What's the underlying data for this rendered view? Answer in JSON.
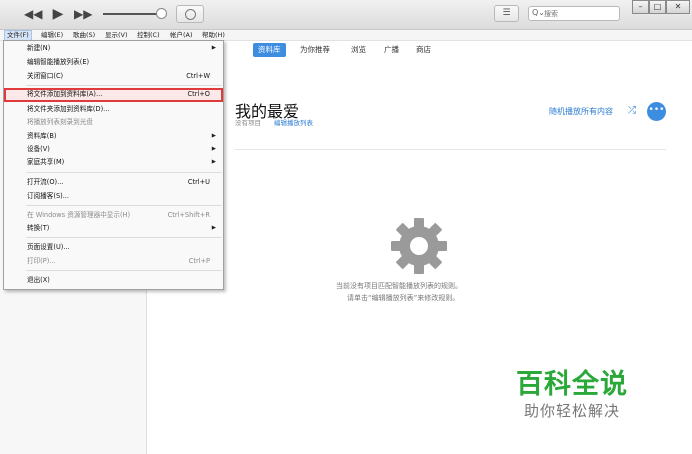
{
  "player": {
    "prev_icon": "◀◀",
    "play_icon": "▶",
    "next_icon": "▶▶",
    "list_icon": "☰",
    "search_placeholder": "搜索",
    "search_icon": "Q⌄",
    "minimize": "–",
    "restore": "□",
    "close": "✕"
  },
  "menubar": {
    "items": [
      {
        "label": "文件(F)"
      },
      {
        "label": "编辑(E)"
      },
      {
        "label": "歌曲(S)"
      },
      {
        "label": "显示(V)"
      },
      {
        "label": "控制(C)"
      },
      {
        "label": "帐户(A)"
      },
      {
        "label": "帮助(H)"
      }
    ]
  },
  "file_menu": {
    "items": [
      {
        "label": "新建(N)",
        "shortcut": "",
        "submenu": true,
        "disabled": false
      },
      {
        "label": "编辑智能播放列表(E)",
        "shortcut": "",
        "submenu": false,
        "disabled": false
      },
      {
        "label": "关闭窗口(C)",
        "shortcut": "Ctrl+W",
        "submenu": false,
        "disabled": false
      },
      {
        "label": "将文件添加到资料库(A)...",
        "shortcut": "Ctrl+O",
        "submenu": false,
        "disabled": false,
        "highlighted": true
      },
      {
        "label": "将文件夹添加到资料库(D)...",
        "shortcut": "",
        "submenu": false,
        "disabled": false
      },
      {
        "label": "将播放列表刻录到光盘",
        "shortcut": "",
        "submenu": false,
        "disabled": true
      },
      {
        "label": "资料库(B)",
        "shortcut": "",
        "submenu": true,
        "disabled": false
      },
      {
        "label": "设备(V)",
        "shortcut": "",
        "submenu": true,
        "disabled": false
      },
      {
        "label": "家庭共享(M)",
        "shortcut": "",
        "submenu": true,
        "disabled": false
      },
      {
        "label": "打开流(O)...",
        "shortcut": "Ctrl+U",
        "submenu": false,
        "disabled": false
      },
      {
        "label": "订阅播客(S)...",
        "shortcut": "",
        "submenu": false,
        "disabled": false
      },
      {
        "label": "在 Windows 资源管理器中显示(H)",
        "shortcut": "Ctrl+Shift+R",
        "submenu": false,
        "disabled": true
      },
      {
        "label": "转换(T)",
        "shortcut": "",
        "submenu": true,
        "disabled": false
      },
      {
        "label": "页面设置(U)...",
        "shortcut": "",
        "submenu": false,
        "disabled": false
      },
      {
        "label": "打印(P)...",
        "shortcut": "Ctrl+P",
        "submenu": false,
        "disabled": true
      },
      {
        "label": "退出(X)",
        "shortcut": "",
        "submenu": false,
        "disabled": false
      }
    ]
  },
  "tabs": [
    {
      "label": "资料库"
    },
    {
      "label": "为你推荐"
    },
    {
      "label": "浏览"
    },
    {
      "label": "广播"
    },
    {
      "label": "商店"
    }
  ],
  "playlist": {
    "title": "我的最爱",
    "subtitle": "没有项目",
    "edit_link": "编辑播放列表",
    "shuffle_label": "随机播放所有内容",
    "shuffle_icon": "⤮",
    "more_icon": "•••",
    "empty_line1": "当前没有项目匹配智能播放列表的规则。",
    "empty_line2": "请单击“编辑播放列表”来修改规则。"
  },
  "watermark": {
    "title": "百科全说",
    "subtitle": "助你轻松解决"
  },
  "colors": {
    "accent": "#3d8de0",
    "link": "#2d7dd2",
    "highlight_border": "#e13a3a",
    "watermark_green": "#2aa83a"
  }
}
